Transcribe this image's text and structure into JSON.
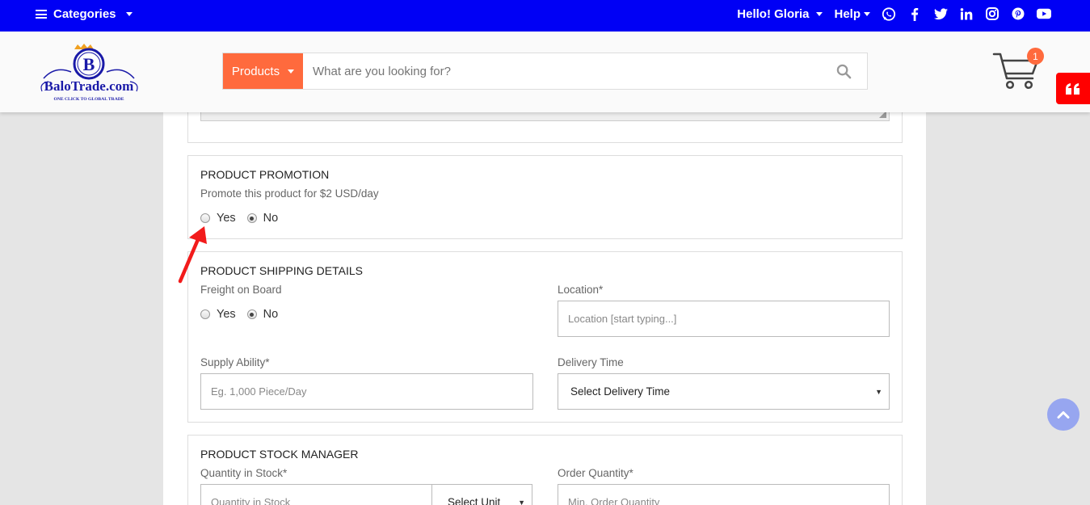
{
  "topbar": {
    "categories_label": "Categories",
    "greeting": "Hello! Gloria",
    "help_label": "Help",
    "social_icons": [
      "whatsapp-icon",
      "facebook-icon",
      "twitter-icon",
      "linkedin-icon",
      "instagram-icon",
      "pinterest-icon",
      "youtube-icon"
    ]
  },
  "header": {
    "logo_text": "BaloTrade.com",
    "logo_tagline": "ONE CLICK TO GLOBAL TRADE",
    "logo_letter": "B",
    "search_category": "Products",
    "search_placeholder": "What are you looking for?",
    "cart_count": "1"
  },
  "promotion": {
    "title": "PRODUCT PROMOTION",
    "subtitle": "Promote this product for $2 USD/day",
    "options": [
      "Yes",
      "No"
    ],
    "selected": "No"
  },
  "shipping": {
    "title": "PRODUCT SHIPPING DETAILS",
    "fob_label": "Freight on Board",
    "fob_options": [
      "Yes",
      "No"
    ],
    "fob_selected": "No",
    "location_label": "Location*",
    "location_placeholder": "Location [start typing...]",
    "supply_label": "Supply Ability*",
    "supply_placeholder": "Eg. 1,000 Piece/Day",
    "delivery_label": "Delivery Time",
    "delivery_value": "Select Delivery Time"
  },
  "stock": {
    "title": "PRODUCT STOCK MANAGER",
    "quantity_label": "Quantity in Stock*",
    "quantity_placeholder": "Quantity in Stock",
    "unit_value": "Select Unit",
    "order_label": "Order Quantity*",
    "order_placeholder": "Min. Order Quantity"
  },
  "colors": {
    "topbar": "#0000f5",
    "accent_orange": "#ff6a3d",
    "quote_red": "#ff0000",
    "arrow_red": "#f21b1b",
    "scroll_top": "#97a6f0"
  }
}
